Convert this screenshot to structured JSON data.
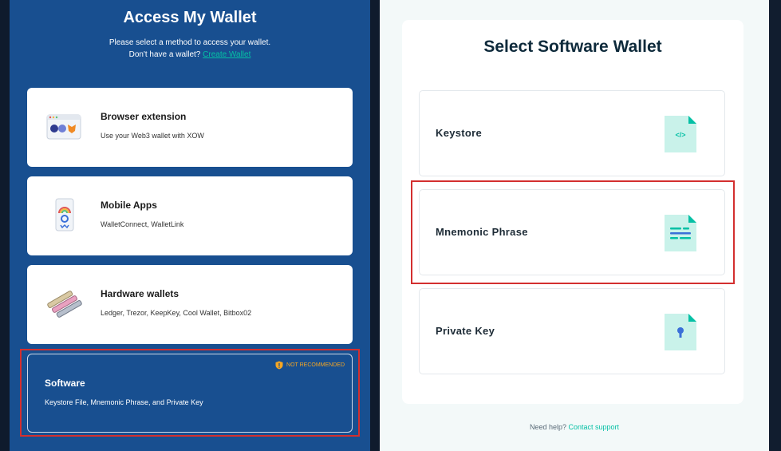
{
  "left": {
    "title": "Access My Wallet",
    "subtitle_line1": "Please select a method to access your wallet.",
    "subtitle_line2_prefix": "Don't have a wallet?",
    "create_wallet_link": "Create Wallet"
  },
  "options": [
    {
      "title": "Browser extension",
      "desc": "Use your Web3 wallet with XOW",
      "icon": "browser-extension-icon"
    },
    {
      "title": "Mobile Apps",
      "desc": "WalletConnect, WalletLink",
      "icon": "mobile-phone-icon"
    },
    {
      "title": "Hardware wallets",
      "desc": "Ledger, Trezor, KeepKey, Cool Wallet, Bitbox02",
      "icon": "hardware-wallet-icon"
    },
    {
      "title": "Software",
      "desc": "Keystore File, Mnemonic Phrase, and Private Key",
      "badge": "NOT RECOMMENDED",
      "icon": "shield-warning-icon"
    }
  ],
  "right": {
    "title": "Select Software Wallet",
    "wallets": [
      {
        "label": "Keystore",
        "icon": "code-file-icon"
      },
      {
        "label": "Mnemonic Phrase",
        "icon": "text-file-icon"
      },
      {
        "label": "Private Key",
        "icon": "key-file-icon"
      }
    ],
    "help_prefix": "Need help?",
    "support_link": "Contact support"
  },
  "colors": {
    "left_panel": "#184f90",
    "accent": "#05c0a5",
    "warning": "#f5a623",
    "highlight": "#d32f2f",
    "icon_bg": "#c9f2ea"
  }
}
